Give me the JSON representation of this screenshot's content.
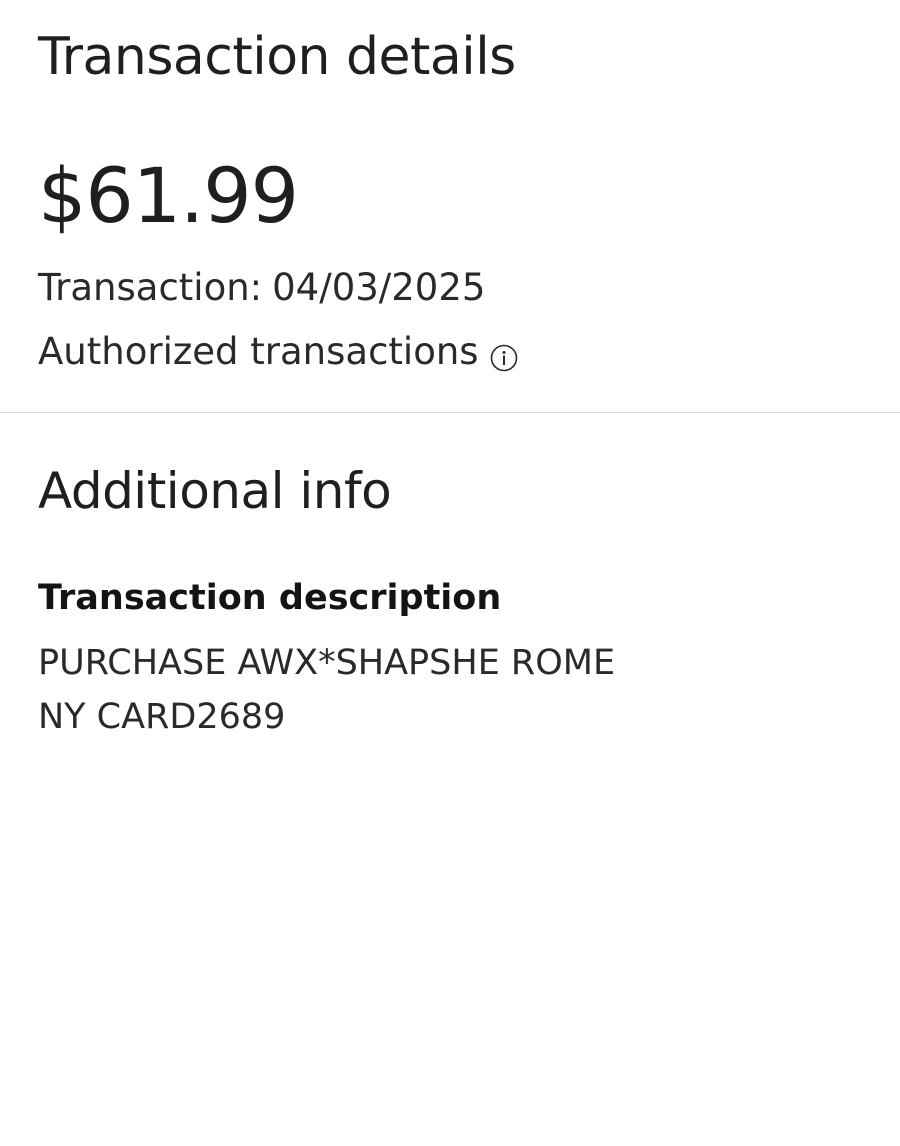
{
  "header": {
    "title": "Transaction details"
  },
  "transaction": {
    "amount": "$61.99",
    "date_label": "Transaction:",
    "date_value": "04/03/2025",
    "status_text": "Authorized transactions",
    "status_icon": "info-icon"
  },
  "additional_info": {
    "title": "Additional info",
    "description_label": "Transaction description",
    "description_lines": [
      "PURCHASE AWX*SHAPSHE ROME",
      "NY CARD2689"
    ]
  },
  "colors": {
    "text_primary": "#1f1f1f",
    "text_secondary": "#2a2a2a",
    "divider": "#d9d9d9",
    "background": "#ffffff"
  }
}
